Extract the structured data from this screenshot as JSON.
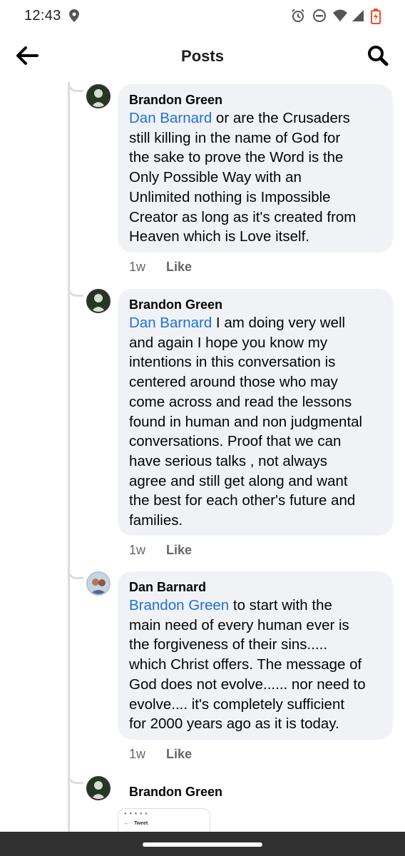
{
  "status_bar": {
    "time": "12:43",
    "icons": [
      "location-icon",
      "alarm-icon",
      "do-not-disturb-icon",
      "wifi-icon",
      "signal-icon",
      "battery-icon"
    ]
  },
  "app_bar": {
    "title": "Posts",
    "back_icon": "arrow-left-icon",
    "search_icon": "search-icon"
  },
  "comments": [
    {
      "author": "Brandon Green",
      "mention": "Dan Barnard",
      "text": " or are the Crusaders\nstill killing in the name of God for\nthe sake to prove the Word is the\nOnly Possible Way with an\nUnlimited nothing is Impossible\nCreator as long as it's created from\nHeaven which is Love itself.",
      "time": "1w",
      "like_label": "Like"
    },
    {
      "author": "Brandon Green",
      "mention": "Dan Barnard",
      "text": " I am doing very well\nand again I hope you know my\nintentions in this conversation is\ncentered around those who may\ncome across and read the lessons\nfound in human and non judgmental\nconversations. Proof that we can\nhave serious talks , not always\nagree and still get along and want\nthe best for each other's future and\nfamilies.",
      "time": "1w",
      "like_label": "Like"
    },
    {
      "author": "Dan Barnard",
      "mention": "Brandon Green",
      "text": " to start with the\nmain need of every human ever is\nthe forgiveness of their sins.....\nwhich Christ offers. The message of\nGod does not evolve...... nor need to\nevolve.... it's completely sufficient\nfor 2000 years ago as it is today.",
      "time": "1w",
      "like_label": "Like"
    },
    {
      "author": "Brandon Green"
    }
  ],
  "embed_preview": {
    "title": "Tweet"
  },
  "colors": {
    "mention": "#216fdb",
    "bubble": "#f0f2f5",
    "meta": "#65676b",
    "nav_bar": "#303030",
    "battery_accent": "#e8502c"
  }
}
